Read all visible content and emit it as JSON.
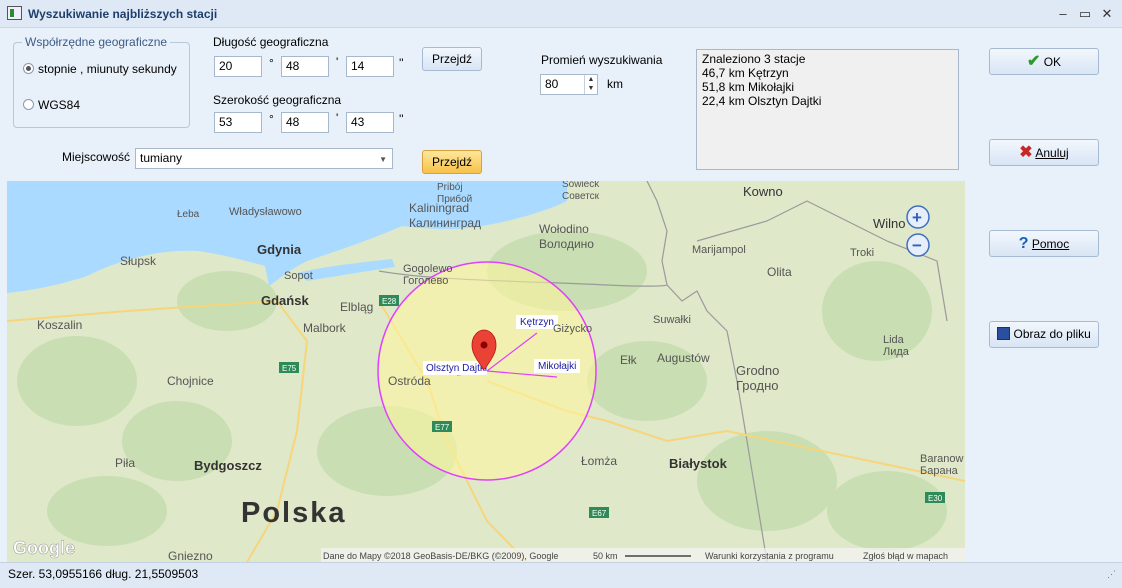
{
  "window": {
    "title": "Wyszukiwanie najbliższych stacji",
    "minimize": "‒",
    "maximize": "▭",
    "close": "✕"
  },
  "coords_group": {
    "legend": "Współrzędne geograficzne",
    "option_dms": "stopnie , miunuty sekundy",
    "option_wgs": "WGS84"
  },
  "longitude": {
    "label": "Długość geograficzna",
    "deg": "20",
    "min": "48",
    "sec": "14",
    "deg_sym": "°",
    "min_sym": "'",
    "sec_sym": "''"
  },
  "latitude": {
    "label": "Szerokość geograficzna",
    "deg": "53",
    "min": "48",
    "sec": "43",
    "deg_sym": "°",
    "min_sym": "'",
    "sec_sym": "''"
  },
  "go_button_1": "Przejdź",
  "go_button_2": "Przejdź",
  "radius": {
    "label": "Promień wyszukiwania",
    "value": "80",
    "unit": "km"
  },
  "locality": {
    "label": "Miejscowość",
    "value": "tumiany"
  },
  "results": {
    "lines": [
      "Znaleziono 3 stacje",
      "46,7 km Kętrzyn",
      "51,8 km Mikołajki",
      "22,4 km Olsztyn Dajtki"
    ]
  },
  "side_buttons": {
    "ok": "OK",
    "cancel": "Anuluj",
    "help": "Pomoc",
    "save_image": "Obraz do pliku"
  },
  "map": {
    "cities": [
      "Kowno",
      "Kaliningrad",
      "Калининград",
      "Wołodino",
      "Володино",
      "Wilno",
      "Gdynia",
      "Sopot",
      "Gdańsk",
      "Elbląg",
      "Słupsk",
      "Koszalin",
      "Malbork",
      "Gogolewo",
      "Гоголево",
      "Marijampol",
      "Olita",
      "Troki",
      "Suwałki",
      "Lida",
      "Лида",
      "Ełk",
      "Augustów",
      "Grodno",
      "Гродно",
      "Ostróda",
      "Chojnice",
      "Piła",
      "Bydgoszcz",
      "Łomża",
      "Białystok",
      "Baranow",
      "Барана",
      "Gniezno",
      "Łeba",
      "Władysławowo",
      "Pribój",
      "Прибой",
      "Sowieck",
      "Советск",
      "Giżycko"
    ],
    "country": "Polska",
    "stations": [
      "Kętrzyn",
      "Mikołajki",
      "Olsztyn Dajtki"
    ],
    "roads": [
      "E28",
      "E75",
      "E77",
      "E67",
      "E30"
    ],
    "zoom_in": "+",
    "zoom_out": "−",
    "google_logo": "Google",
    "attribution": "Dane do Mapy ©2018 GeoBasis-DE/BKG (©2009), Google",
    "scale": "50 km",
    "terms": "Warunki korzystania z programu",
    "report": "Zgłoś błąd w mapach",
    "colors": {
      "sea": "#aadaff",
      "land": "#dde8c8",
      "circle_fill": "#fff59d",
      "circle_stroke": "#e040fb",
      "marker": "#ea4335"
    }
  },
  "status": "Szer. 53,0955166 dług. 21,5509503"
}
